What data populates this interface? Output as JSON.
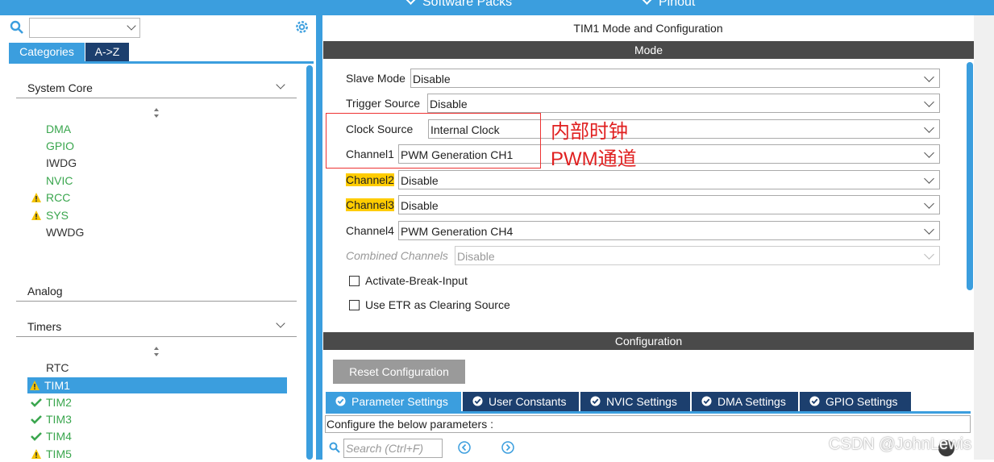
{
  "topbar": {
    "software_packs": "Software Packs",
    "pinout": "Pinout"
  },
  "left": {
    "tabs": {
      "categories": "Categories",
      "az": "A->Z"
    },
    "categories": [
      {
        "label": "System Core",
        "expanded": true
      },
      {
        "label": "Analog",
        "expanded": false
      },
      {
        "label": "Timers",
        "expanded": true
      }
    ],
    "system_core_items": [
      {
        "label": "DMA",
        "status": "ok"
      },
      {
        "label": "GPIO",
        "status": "ok"
      },
      {
        "label": "IWDG",
        "status": "none"
      },
      {
        "label": "NVIC",
        "status": "ok"
      },
      {
        "label": "RCC",
        "status": "warning"
      },
      {
        "label": "SYS",
        "status": "warning"
      },
      {
        "label": "WWDG",
        "status": "none"
      }
    ],
    "timer_items": [
      {
        "label": "RTC",
        "status": "none"
      },
      {
        "label": "TIM1",
        "status": "warning",
        "selected": true
      },
      {
        "label": "TIM2",
        "status": "check"
      },
      {
        "label": "TIM3",
        "status": "check"
      },
      {
        "label": "TIM4",
        "status": "check"
      },
      {
        "label": "TIM5",
        "status": "warning"
      }
    ]
  },
  "right": {
    "title": "TIM1 Mode and Configuration",
    "mode_header": "Mode",
    "config_header": "Configuration",
    "mode_rows": [
      {
        "label": "Slave Mode",
        "value": "Disable"
      },
      {
        "label": "Trigger Source",
        "value": "Disable"
      },
      {
        "label": "Clock Source",
        "value": "Internal Clock"
      },
      {
        "label": "Channel1",
        "value": "PWM Generation CH1"
      },
      {
        "label": "Channel2",
        "value": "Disable"
      },
      {
        "label": "Channel3",
        "value": "Disable"
      },
      {
        "label": "Channel4",
        "value": "PWM Generation CH4"
      },
      {
        "label": "Combined Channels",
        "value": "Disable"
      }
    ],
    "checkboxes": [
      {
        "label": "Activate-Break-Input",
        "checked": false
      },
      {
        "label": "Use ETR as Clearing Source",
        "checked": false
      }
    ],
    "annotations": {
      "clock": "内部时钟",
      "pwm": "PWM通道"
    },
    "reset_button": "Reset Configuration",
    "config_tabs": [
      "Parameter Settings",
      "User Constants",
      "NVIC Settings",
      "DMA Settings",
      "GPIO Settings"
    ],
    "param_hint": "Configure the below parameters :",
    "search_placeholder": "Search (Ctrl+F)"
  },
  "watermark": "CSDN @JohnLewis",
  "colors": {
    "accent": "#3b9ede",
    "dark_tab": "#1c3f6e",
    "ok": "#3aa64e",
    "warn": "#f5c400",
    "highlight": "#ffcc00",
    "annotation": "#e02020"
  }
}
